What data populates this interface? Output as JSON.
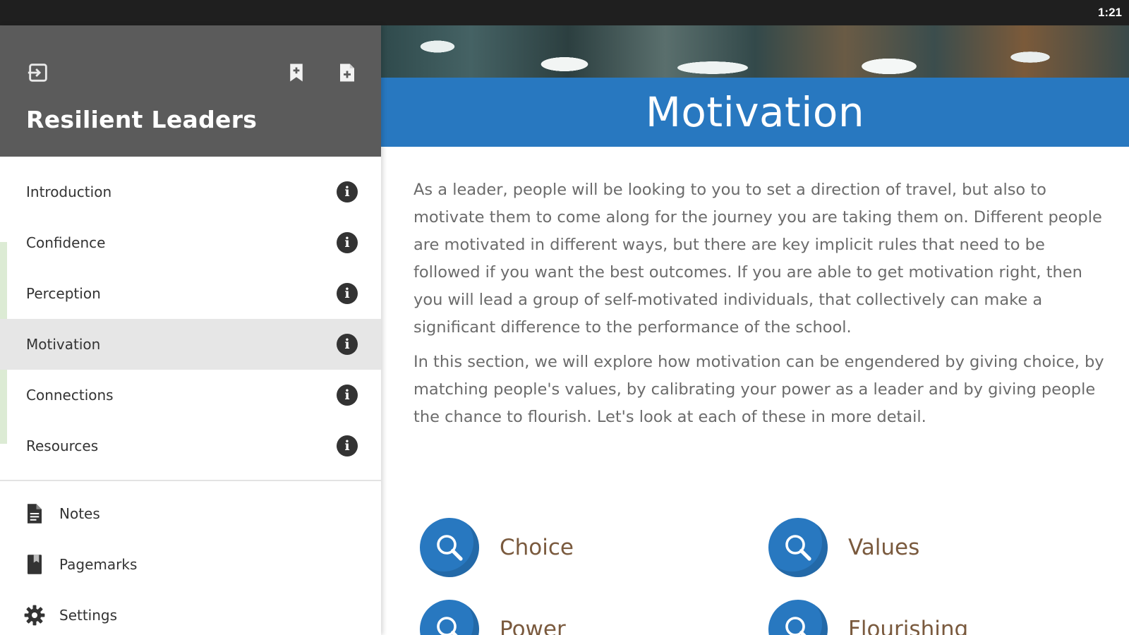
{
  "status_bar": {
    "time": "1:21"
  },
  "drawer": {
    "title": "Resilient Leaders",
    "header_icons": [
      "exit-icon",
      "bookmark-add-icon",
      "note-add-icon"
    ],
    "chapters": [
      {
        "label": "Introduction",
        "icon": "info-icon",
        "active": false
      },
      {
        "label": "Confidence",
        "icon": "info-icon",
        "active": false
      },
      {
        "label": "Perception",
        "icon": "info-icon",
        "active": false
      },
      {
        "label": "Motivation",
        "icon": "info-icon",
        "active": true
      },
      {
        "label": "Connections",
        "icon": "info-icon",
        "active": false
      },
      {
        "label": "Resources",
        "icon": "info-icon",
        "active": false
      }
    ],
    "tools": [
      {
        "label": "Notes",
        "icon": "notes-icon"
      },
      {
        "label": "Pagemarks",
        "icon": "pagemarks-icon"
      },
      {
        "label": "Settings",
        "icon": "settings-icon"
      }
    ]
  },
  "content": {
    "title": "Motivation",
    "paragraphs": [
      "As a leader, people will be looking to you to set a direction of travel, but also to motivate them to come along for the journey you are taking them on. Different people are motivated in different ways, but there are key implicit rules that need to be followed if you want the best outcomes. If you are able to get motivation right, then you will lead a group of self-motivated individuals, that collectively can make a significant difference to the performance of the school.",
      "In this section, we will explore how motivation can be engendered by giving choice, by matching people's values, by calibrating your power as a leader and by giving people the chance to flourish. Let's look at each of these in more detail."
    ],
    "topics": [
      {
        "label": "Choice",
        "icon": "magnifier-icon"
      },
      {
        "label": "Values",
        "icon": "magnifier-icon"
      },
      {
        "label": "Power",
        "icon": "magnifier-icon"
      },
      {
        "label": "Flourishing",
        "icon": "magnifier-icon"
      }
    ]
  },
  "colors": {
    "accent_blue": "#2878c0",
    "drawer_header": "#5b5b5b",
    "active_row": "#e6e6e6",
    "topic_label": "#7a5a3e",
    "body_text": "#6b6b6b"
  }
}
